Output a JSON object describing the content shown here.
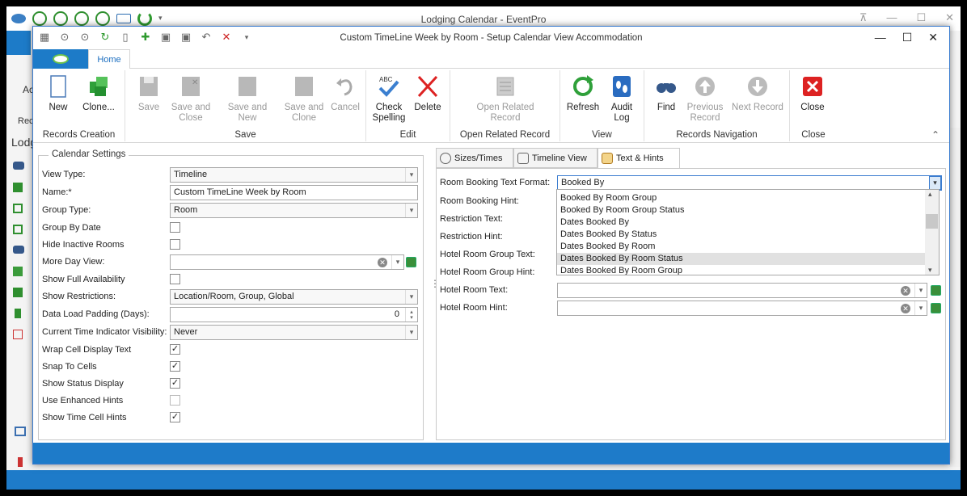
{
  "app": {
    "title": "Lodging Calendar - EventPro",
    "left_labels": [
      "Ac",
      "Rec",
      "Lodg"
    ]
  },
  "dialog": {
    "title": "Custom TimeLine Week by Room - Setup Calendar View Accommodation"
  },
  "ribbon": {
    "tab_home": "Home",
    "groups": [
      {
        "title": "Records Creation",
        "buttons": [
          {
            "label": "New"
          },
          {
            "label": "Clone..."
          }
        ]
      },
      {
        "title": "Save",
        "buttons": [
          {
            "label": "Save"
          },
          {
            "label": "Save and Close"
          },
          {
            "label": "Save and New"
          },
          {
            "label": "Save and Clone"
          },
          {
            "label": "Cancel"
          }
        ]
      },
      {
        "title": "Edit",
        "buttons": [
          {
            "label": "Check Spelling"
          },
          {
            "label": "Delete"
          }
        ]
      },
      {
        "title": "Open Related Record",
        "buttons": [
          {
            "label": "Open Related Record"
          }
        ]
      },
      {
        "title": "View",
        "buttons": [
          {
            "label": "Refresh"
          },
          {
            "label": "Audit Log"
          }
        ]
      },
      {
        "title": "Records Navigation",
        "buttons": [
          {
            "label": "Find"
          },
          {
            "label": "Previous Record"
          },
          {
            "label": "Next Record"
          }
        ]
      },
      {
        "title": "Close",
        "buttons": [
          {
            "label": "Close"
          }
        ]
      }
    ]
  },
  "calendar_settings": {
    "legend": "Calendar Settings",
    "view_type": {
      "label": "View Type:",
      "value": "Timeline"
    },
    "name": {
      "label": "Name:*",
      "value": "Custom TimeLine Week by Room"
    },
    "group_type": {
      "label": "Group Type:",
      "value": "Room"
    },
    "group_by_date": {
      "label": "Group By Date",
      "checked": false
    },
    "hide_inactive_rooms": {
      "label": "Hide Inactive Rooms",
      "checked": false
    },
    "more_day_view": {
      "label": "More Day View:",
      "value": ""
    },
    "show_full_availability": {
      "label": "Show Full Availability",
      "checked": false
    },
    "show_restrictions": {
      "label": "Show Restrictions:",
      "value": "Location/Room, Group, Global"
    },
    "data_load_padding": {
      "label": "Data Load Padding (Days):",
      "value": "0"
    },
    "current_time_indicator": {
      "label": "Current Time Indicator Visibility:",
      "value": "Never"
    },
    "wrap_cell_display_text": {
      "label": "Wrap Cell Display Text",
      "checked": true
    },
    "snap_to_cells": {
      "label": "Snap To Cells",
      "checked": true
    },
    "show_status_display": {
      "label": "Show Status Display",
      "checked": true
    },
    "use_enhanced_hints": {
      "label": "Use Enhanced Hints",
      "checked": false
    },
    "show_time_cell_hints": {
      "label": "Show Time Cell Hints",
      "checked": true
    }
  },
  "right_tabs": [
    "Sizes/Times",
    "Timeline View",
    "Text & Hints"
  ],
  "text_hints": {
    "room_booking_text_format": {
      "label": "Room Booking Text Format:",
      "value": "Booked By"
    },
    "room_booking_hint": {
      "label": "Room Booking Hint:"
    },
    "restriction_text": {
      "label": "Restriction Text:"
    },
    "restriction_hint": {
      "label": "Restriction Hint:"
    },
    "hotel_room_group_text": {
      "label": "Hotel Room Group Text:"
    },
    "hotel_room_group_hint": {
      "label": "Hotel Room Group Hint:"
    },
    "hotel_room_text": {
      "label": "Hotel Room Text:",
      "value": ""
    },
    "hotel_room_hint": {
      "label": "Hotel Room Hint:",
      "value": ""
    }
  },
  "dropdown": {
    "items": [
      "Booked By Room Group",
      "Booked By Room Group Status",
      "Dates Booked By",
      "Dates Booked By Status",
      "Dates Booked By Room",
      "Dates Booked By Room Status",
      "Dates Booked By Room Group"
    ],
    "selected": "Dates Booked By Room Status"
  },
  "colors": {
    "accent_blue": "#1d7bc8",
    "selected_item": "#e1e1e1"
  }
}
